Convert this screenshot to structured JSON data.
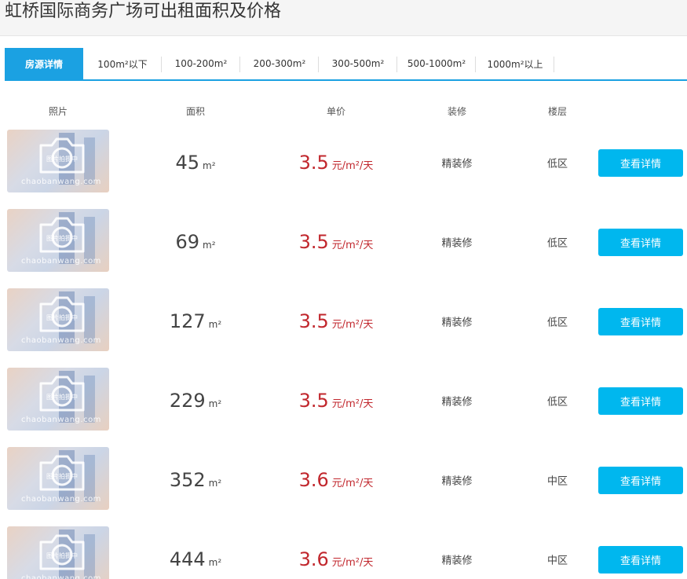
{
  "page": {
    "title": "虹桥国际商务广场可出租面积及价格"
  },
  "tabs": [
    {
      "label": "房源详情",
      "active": true
    },
    {
      "label": "100m²以下"
    },
    {
      "label": "100-200m²"
    },
    {
      "label": "200-300m²"
    },
    {
      "label": "300-500m²"
    },
    {
      "label": "500-1000m²"
    },
    {
      "label": "1000m²以上"
    }
  ],
  "columns": {
    "photo": "照片",
    "area": "面积",
    "price": "单价",
    "decoration": "装修",
    "floor": "楼层"
  },
  "thumb": {
    "watermark": "chaobanwang.com",
    "caption": "图片拍摄中"
  },
  "units": {
    "area": "m²",
    "price": "元/m²/天"
  },
  "button_label": "查看详情",
  "colors": {
    "accent": "#1ba1e2",
    "button": "#00b7ee",
    "price": "#c1272d"
  },
  "listings": [
    {
      "area": "45",
      "price": "3.5",
      "decoration": "精装修",
      "floor": "低区"
    },
    {
      "area": "69",
      "price": "3.5",
      "decoration": "精装修",
      "floor": "低区"
    },
    {
      "area": "127",
      "price": "3.5",
      "decoration": "精装修",
      "floor": "低区"
    },
    {
      "area": "229",
      "price": "3.5",
      "decoration": "精装修",
      "floor": "低区"
    },
    {
      "area": "352",
      "price": "3.6",
      "decoration": "精装修",
      "floor": "中区"
    },
    {
      "area": "444",
      "price": "3.6",
      "decoration": "精装修",
      "floor": "中区"
    }
  ]
}
